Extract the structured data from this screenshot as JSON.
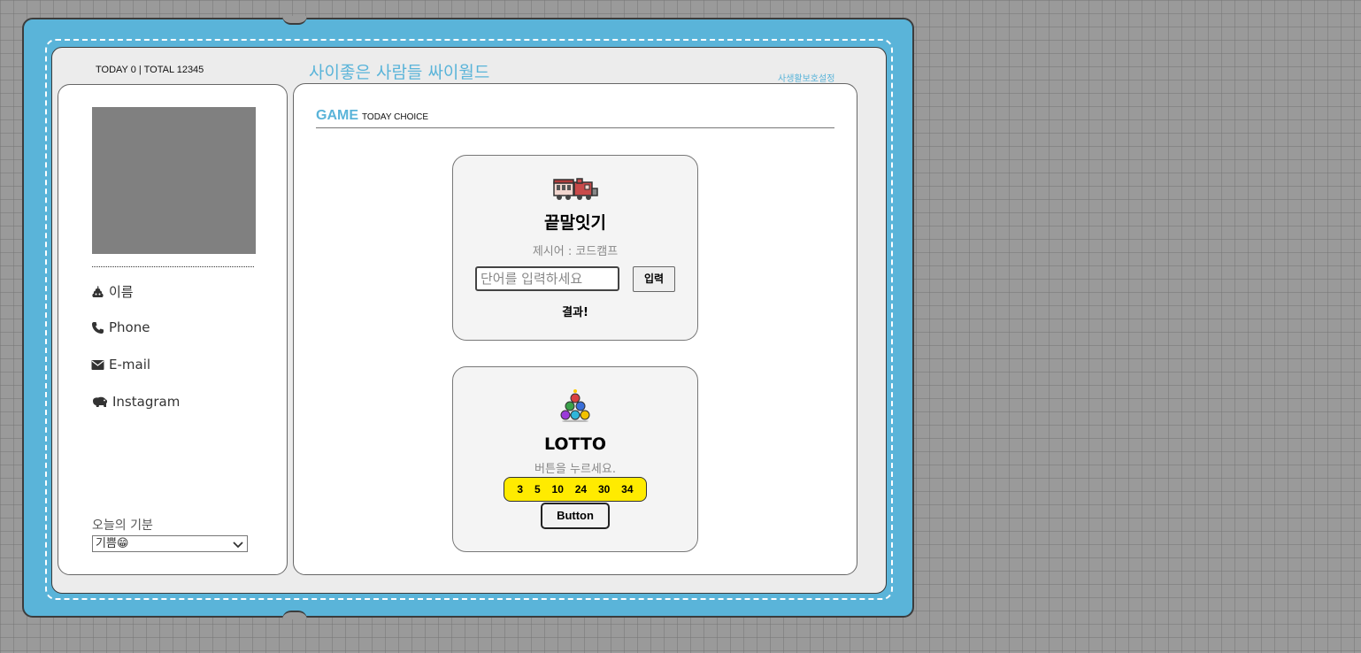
{
  "header": {
    "counter": "TODAY 0 | TOTAL 12345",
    "site_title": "사이좋은 사람들 싸이월드",
    "privacy_link": "사생활보호설정"
  },
  "profile": {
    "name_label": "이름",
    "phone_label": "Phone",
    "email_label": "E-mail",
    "instagram_label": "Instagram",
    "mood_label": "오늘의 기분",
    "mood_selected": "기쁨😁"
  },
  "game": {
    "title": "GAME",
    "subtitle": "TODAY CHOICE"
  },
  "word_game": {
    "title": "끝말잇기",
    "prompt": "제시어 : 코드캠프",
    "input_placeholder": "단어를 입력하세요",
    "submit_label": "입력",
    "result": "결과!"
  },
  "lotto": {
    "title": "LOTTO",
    "prompt": "버튼을 누르세요.",
    "numbers": [
      "3",
      "5",
      "10",
      "24",
      "30",
      "34"
    ],
    "button_label": "Button"
  },
  "colors": {
    "accent": "#5ab4d9",
    "lotto_yellow": "#ffeb00",
    "photo_placeholder": "#808080"
  }
}
